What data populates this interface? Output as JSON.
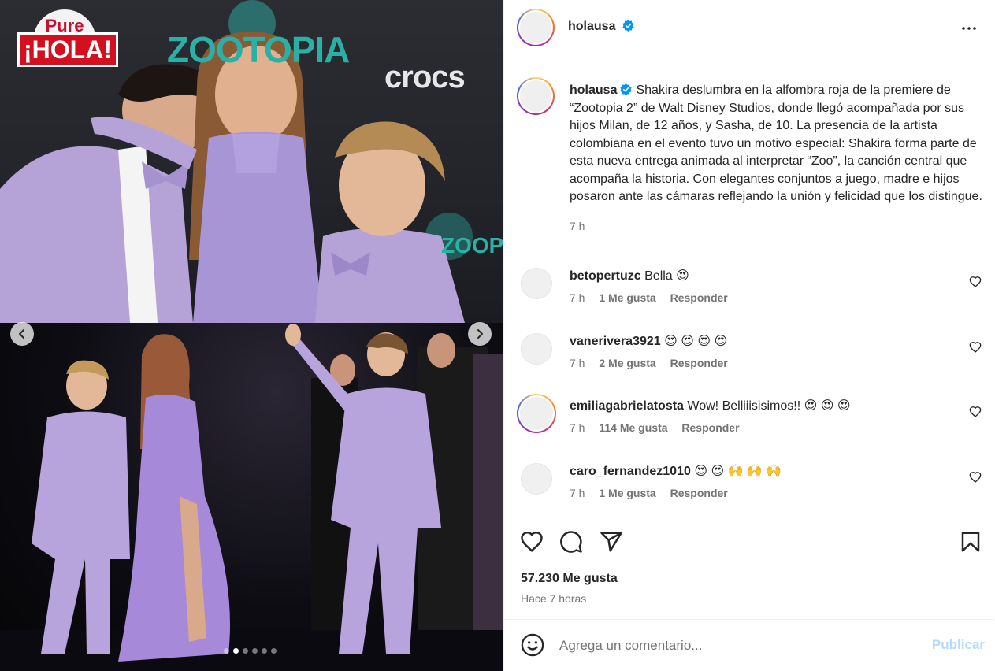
{
  "media": {
    "logo_top": "Pure",
    "logo_main": "¡HOLA!",
    "brand_zootopia": "ZOOTOPIA",
    "brand_crocs": "crocs",
    "brand_zootopia_small": "ZOOPIA",
    "dots_count": 6,
    "active_dot": 1
  },
  "header": {
    "username": "holausa"
  },
  "post": {
    "username": "holausa",
    "caption": "Shakira deslumbra en la alfombra roja de la premiere de “Zootopia 2” de Walt Disney Studios, donde llegó acompañada por sus hijos Milan, de 12 años, y Sasha, de 10. La presencia de la artista colombiana en el evento tuvo un motivo especial: Shakira forma parte de esta nueva entrega animada al interpretar “Zoo”, la canción central que acompaña la historia. Con elegantes conjuntos a juego, madre e hijos posaron ante las cámaras reflejando la unión y felicidad que los distingue.",
    "time": "7 h"
  },
  "comments": [
    {
      "username": "betopertuzc",
      "text": "Bella 😍",
      "time": "7 h",
      "likes": "1 Me gusta",
      "reply": "Responder",
      "ring": false
    },
    {
      "username": "vanerivera3921",
      "text": "😍 😍 😍 😍",
      "time": "7 h",
      "likes": "2 Me gusta",
      "reply": "Responder",
      "ring": false
    },
    {
      "username": "emiliagabrielatosta",
      "text": "Wow! Belliiisisimos!! 😍 😍 😍",
      "time": "7 h",
      "likes": "114 Me gusta",
      "reply": "Responder",
      "ring": true
    },
    {
      "username": "caro_fernandez1010",
      "text": "😍 😍 🙌 🙌 🙌",
      "time": "7 h",
      "likes": "1 Me gusta",
      "reply": "Responder",
      "ring": false
    }
  ],
  "footer": {
    "likes_count": "57.230 Me gusta",
    "time_ago": "Hace 7 horas",
    "comment_placeholder": "Agrega un comentario...",
    "publish_label": "Publicar"
  },
  "colors": {
    "verified": "#0095f6",
    "publish_disabled": "#b3dbff",
    "lavender": "#b7a4dd"
  }
}
